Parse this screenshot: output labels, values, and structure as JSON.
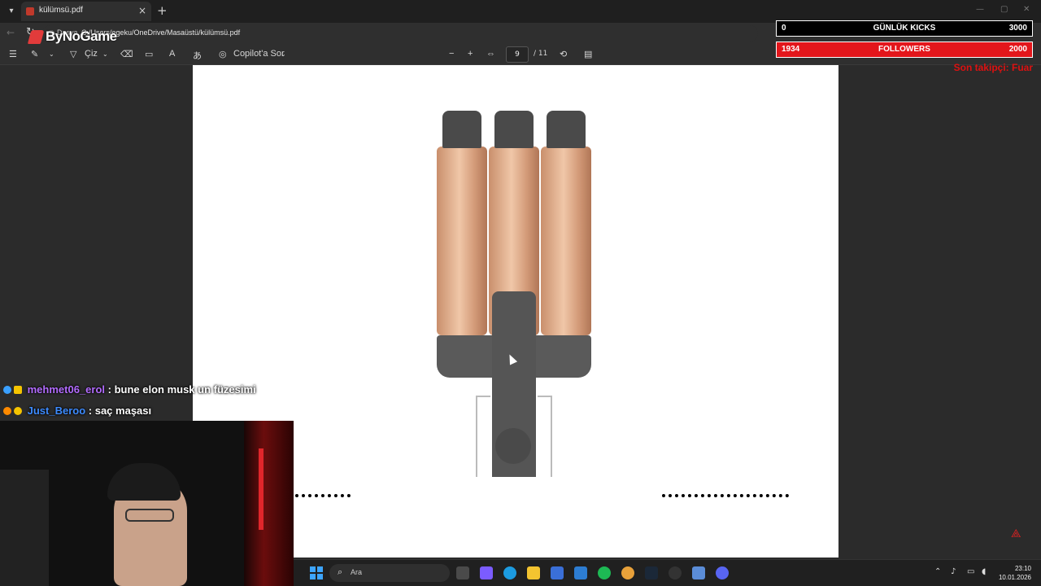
{
  "browser": {
    "tab_title": "külümsü.pdf",
    "url_label": "Dosya",
    "url": "C:/Users/egeku/OneDrive/Masaüstü/külümsü.pdf"
  },
  "brand": {
    "logo_text": "ByNoGame"
  },
  "pdf_toolbar": {
    "draw_label": "Çiz",
    "copilot_label": "Copilot'a Sor",
    "page_current": "9",
    "page_total": "/ 11"
  },
  "widgets": {
    "kicks": {
      "left": "0",
      "label": "GÜNLÜK KICKS",
      "goal": "3000"
    },
    "followers": {
      "left": "1934",
      "label": "FOLLOWERS",
      "goal": "2000"
    },
    "last_follower": "Son takipçi: Fuar"
  },
  "chat": [
    {
      "user": "mehmet06_erol",
      "message": ": bune elon musk un füzesimi"
    },
    {
      "user": "Just_Beroo",
      "message": ": saç maşası"
    }
  ],
  "taskbar": {
    "search_placeholder": "Ara",
    "time": "23:10",
    "date": "10.01.2026"
  },
  "colors": {
    "follower_bar": "#e3161b",
    "accent_blue": "#3d8bff",
    "accent_purple": "#b36cff"
  }
}
